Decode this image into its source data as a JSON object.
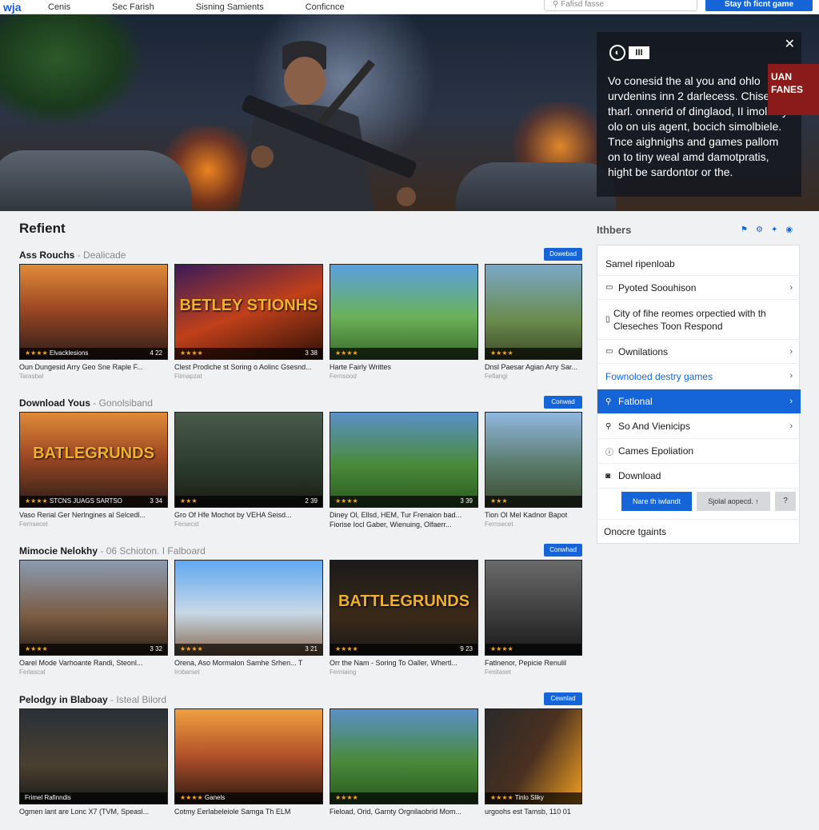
{
  "topbar": {
    "logo": "wja",
    "nav": [
      "Cenis",
      "Sec Farish",
      "Sisning Samients",
      "Conficnce"
    ],
    "search_placeholder": "Fafisd fasse",
    "cta_label": "Stay th ficnt game"
  },
  "hero": {
    "popup": {
      "badge": "III",
      "text": "Vo conesid the al you and ohlo urvdenins inn 2 darlecess. Chisene tharl. onnerid of dinglaod, II imolstay olo on uis agent, bocich simolbiele. Tnce aighnighs and games pallom on to tiny weal amd damotpratis, hight be sardontor or the."
    },
    "overlay_sign": "UAN FANES"
  },
  "main": {
    "title": "Refient",
    "rows": [
      {
        "title": "Ass Rouchs",
        "subtitle": "Dealicade",
        "download_label": "Dowebad",
        "cards": [
          {
            "overlay": "Elvacklesions",
            "rating": "★★★★",
            "score": "4 22",
            "caption": "Oun Dungesid Arry Geo Sne Raple F...",
            "meta": "Tarasbal",
            "theme": "sunset"
          },
          {
            "overlay": "",
            "big_text": "BETLEY STIONHS",
            "rating": "★★★★",
            "score": "3 38",
            "caption": "Clest Prodiche st Soring o Aolinc Gsesnd...",
            "meta": "Fiimapzat",
            "theme": "fire"
          },
          {
            "overlay": "",
            "rating": "★★★★",
            "score": "",
            "caption": "Harte Fairly Writtes",
            "meta": "Fernsood",
            "theme": "tropic"
          },
          {
            "overlay": "",
            "rating": "★★★★",
            "score": "",
            "caption": "Dnsl Paesar Agian Arry Sar...",
            "meta": "Fefiangi",
            "theme": "field"
          }
        ]
      },
      {
        "title": "Download Yous",
        "subtitle": "Gonolsiband",
        "download_label": "Conwad",
        "cards": [
          {
            "overlay": "STCNS JUAGS SARTSO",
            "big_text": "BATLEGRUNDS",
            "rating": "★★★★",
            "score": "3 34",
            "caption": "Vaso Rerial Ger Nerlngines al Selcedl...",
            "meta": "Fernsecet",
            "theme": "sunset"
          },
          {
            "overlay": "",
            "rating": "★★★",
            "score": "2 39",
            "caption": "Gro Of Hfe Mochot by VEHA Seisd...",
            "meta": "Fersecst",
            "theme": "forest"
          },
          {
            "overlay": "",
            "rating": "★★★★",
            "score": "3 39",
            "caption": "Diney Ol, Ellsd, HEM, Tur Frenaion bad...",
            "caption2": "Fiorise Iocl Gaber, Wienuing, Olfaerr...",
            "meta": "",
            "theme": "meadow"
          },
          {
            "overlay": "",
            "rating": "★★★",
            "score": "",
            "caption": "Tion Ol Mel Kadnor Bapot",
            "meta": "Fernsecet",
            "theme": "mountain"
          }
        ]
      },
      {
        "title": "Mimocie Nelokhy",
        "subtitle": "06 Schioton. I Falboard",
        "download_label": "Conwhad",
        "cards": [
          {
            "overlay": "",
            "rating": "★★★★",
            "score": "3 32",
            "caption": "Oarel Mode Varhoante Randi, Steonl...",
            "meta": "Ferlascal",
            "theme": "canyon"
          },
          {
            "overlay": "",
            "rating": "★★★★",
            "score": "3 21",
            "caption": "Orena, Aso Mormalon Samhe Srhen... T",
            "meta": "Irobarset",
            "theme": "sky"
          },
          {
            "overlay": "",
            "big_text": "BATTLEGRUNDS",
            "rating": "★★★★",
            "score": "9 23",
            "caption": "Orr the Nam - Soring To Oaller, Whertl...",
            "meta": "Ferniaing",
            "theme": "dark"
          },
          {
            "overlay": "",
            "rating": "★★★★",
            "score": "",
            "caption": "Fatlnenor, Pepicie Renulil",
            "meta": "Fenitaset",
            "theme": "grey"
          }
        ]
      },
      {
        "title": "Pelodgy in Blaboay",
        "subtitle": "Isteal Bilord",
        "download_label": "Cewnlad",
        "cards": [
          {
            "overlay": "Frimel Rafinndis",
            "rating": "",
            "score": "",
            "caption": "Ogmen lant are Lonc X7 (TVM, Speasl...",
            "meta": "",
            "theme": "gunner"
          },
          {
            "overlay": "Ganels",
            "rating": "★★★★",
            "score": "",
            "caption": "Cotmy Eerlabeleiole Samga Th ELM",
            "meta": "",
            "theme": "sunset2"
          },
          {
            "overlay": "",
            "rating": "★★★★",
            "score": "",
            "caption": "Fieload, Orid, Garnty Orgnilaobrid Mom...",
            "meta": "",
            "theme": "meadow"
          },
          {
            "overlay": "Tinlo Sliky",
            "rating": "★★★★",
            "score": "",
            "caption": "urgoohs est Tamsb, 110 01",
            "meta": "",
            "theme": "blast"
          }
        ]
      }
    ]
  },
  "sidebar": {
    "title": "Ithbers",
    "items": [
      {
        "label": "Samel ripenloab",
        "icon": "",
        "chevron": false
      },
      {
        "label": "Pyoted Soouhison",
        "icon": "▭",
        "chevron": true
      },
      {
        "label": "City of fihe reomes orpectied with th Cleseches Toon Respond",
        "icon": "▯",
        "chevron": false
      },
      {
        "label": "Ownilations",
        "icon": "▭",
        "chevron": true
      },
      {
        "label": "Fownoloed destry games",
        "icon": "",
        "chevron": true,
        "accent": true
      },
      {
        "label": "Fatlonal",
        "icon": "⚲",
        "chevron": true,
        "active": true
      },
      {
        "label": "So And Vienicips",
        "icon": "⚲",
        "chevron": true
      },
      {
        "label": "Cames Epoliation",
        "icon": "ⓘ",
        "chevron": false
      },
      {
        "label": "Download",
        "icon": "◙",
        "chevron": false
      }
    ],
    "btn_primary": "Nare th iwlandt",
    "btn_secondary": "Sjolal aopecd. ↑",
    "btn_help": "?",
    "footer": "Onocre tgaints"
  },
  "colors": {
    "accent": "#1565d8",
    "background": "#f0f1f3"
  }
}
